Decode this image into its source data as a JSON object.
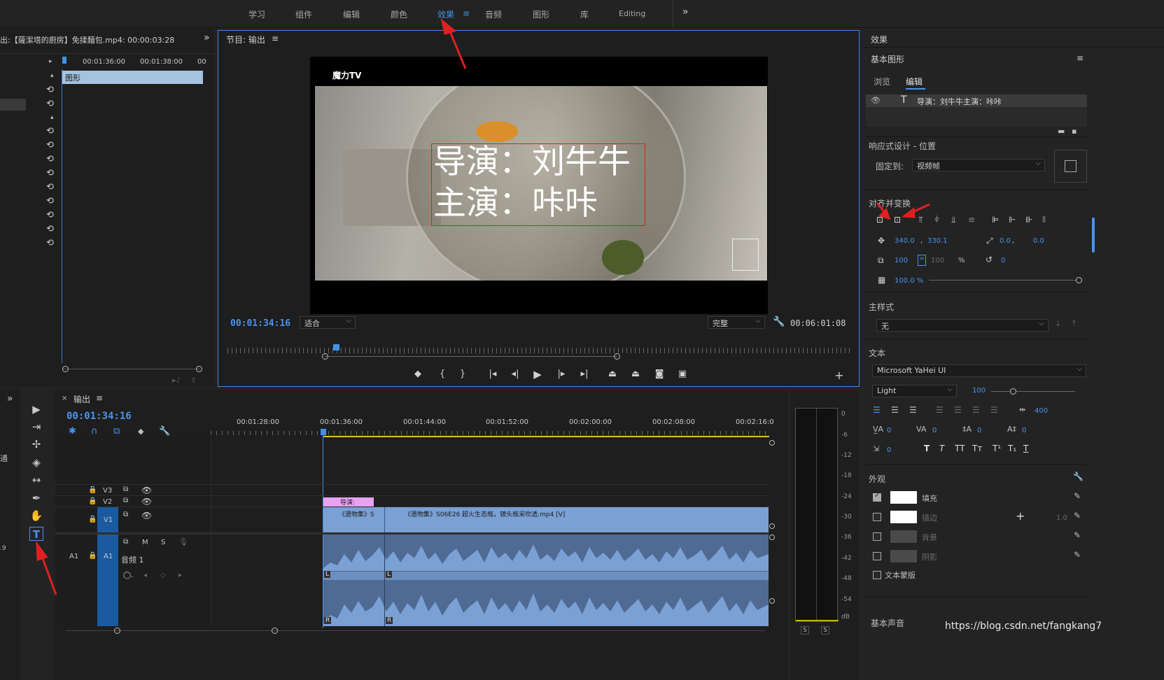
{
  "workspaces": [
    {
      "label": "学习"
    },
    {
      "label": "组件"
    },
    {
      "label": "编辑"
    },
    {
      "label": "颜色"
    },
    {
      "label": "效果"
    },
    {
      "label": "音频"
    },
    {
      "label": "图形"
    },
    {
      "label": "库"
    },
    {
      "label": "Editing"
    }
  ],
  "workspace_more": "»",
  "source_panel": {
    "title": "出:【薩潔塔的廚房】免揉麵包.mp4: 00:00:03:28",
    "ruler_times": [
      "00:01:36:00",
      "00:01:38:00",
      "00"
    ],
    "clip_label": "图形"
  },
  "program_monitor": {
    "title": "节目: 输出",
    "overlay_logo": "魔力TV",
    "caption_line1": "导演：刘牛牛",
    "caption_line2": "主演：咔咔",
    "timecode": "00:01:34:16",
    "fit_select": "适合",
    "quality_select": "完整",
    "duration": "00:06:01:08"
  },
  "timeline": {
    "title": "输出",
    "timecode": "00:01:34:16",
    "ruler_times": [
      "00:01:28:00",
      "00:01:36:00",
      "00:01:44:00",
      "00:01:52:00",
      "00:02:00:00",
      "00:02:08:00",
      "00:02:16:0"
    ],
    "tracks": {
      "v3": "V3",
      "v2": "V2",
      "v1": "V1",
      "a1": "A1",
      "a1_name": "音频 1"
    },
    "graphic_clip": "导演:",
    "video_clip_1": "《遗物集》S",
    "video_clip_2": "《遗物集》S06E26 超火生态瓶，镜头瓶采吹透.mp4 [V]",
    "audio_clip_L": "L",
    "audio_clip_R": "R",
    "mute_label": "M",
    "solo_label": "S"
  },
  "meter": {
    "labels": [
      "0",
      "-6",
      "-12",
      "-18",
      "-24",
      "-30",
      "-36",
      "-42",
      "-48",
      "-54",
      "dB"
    ],
    "solo": [
      "S",
      "S"
    ]
  },
  "effects_panel": {
    "title": "效果",
    "section": "基本图形",
    "tabs": {
      "browse": "浏览",
      "edit": "编辑"
    },
    "layer": "导演：刘牛牛主演：咔咔",
    "responsive_title": "响应式设计 - 位置",
    "pin_label": "固定到:",
    "pin_value": "视频帧",
    "align_title": "对齐并变换",
    "pos_x": "340.0",
    "pos_y": "330.1",
    "anchor_x": "0.0",
    "anchor_y": "0.0",
    "scale": "100",
    "scale2": "100",
    "percent": "%",
    "rotation": "0",
    "opacity": "100.0 %",
    "master_style_title": "主样式",
    "master_style_value": "无",
    "text_title": "文本",
    "font": "Microsoft YaHei UI",
    "font_style": "Light",
    "font_size": "100",
    "tracking_val": "400",
    "kerning_val": "0",
    "tracking2_val": "0",
    "leading_val": "0",
    "baseline_val": "0",
    "tsume_val": "0",
    "appearance_title": "外观",
    "fill_label": "填充",
    "stroke_label": "描边",
    "stroke_width": "1.0",
    "background_label": "背景",
    "shadow_label": "阴影",
    "mask_label": "文本蒙版",
    "basic_sound": "基本声音",
    "watermark": "https://blog.csdn.net/fangkang7"
  },
  "colors": {
    "accent": "#3f92e6",
    "clip_video": "#7aa0d4",
    "clip_graphic": "#e7a2f2",
    "arrow": "#e02020",
    "playhead": "#3f92e6"
  }
}
